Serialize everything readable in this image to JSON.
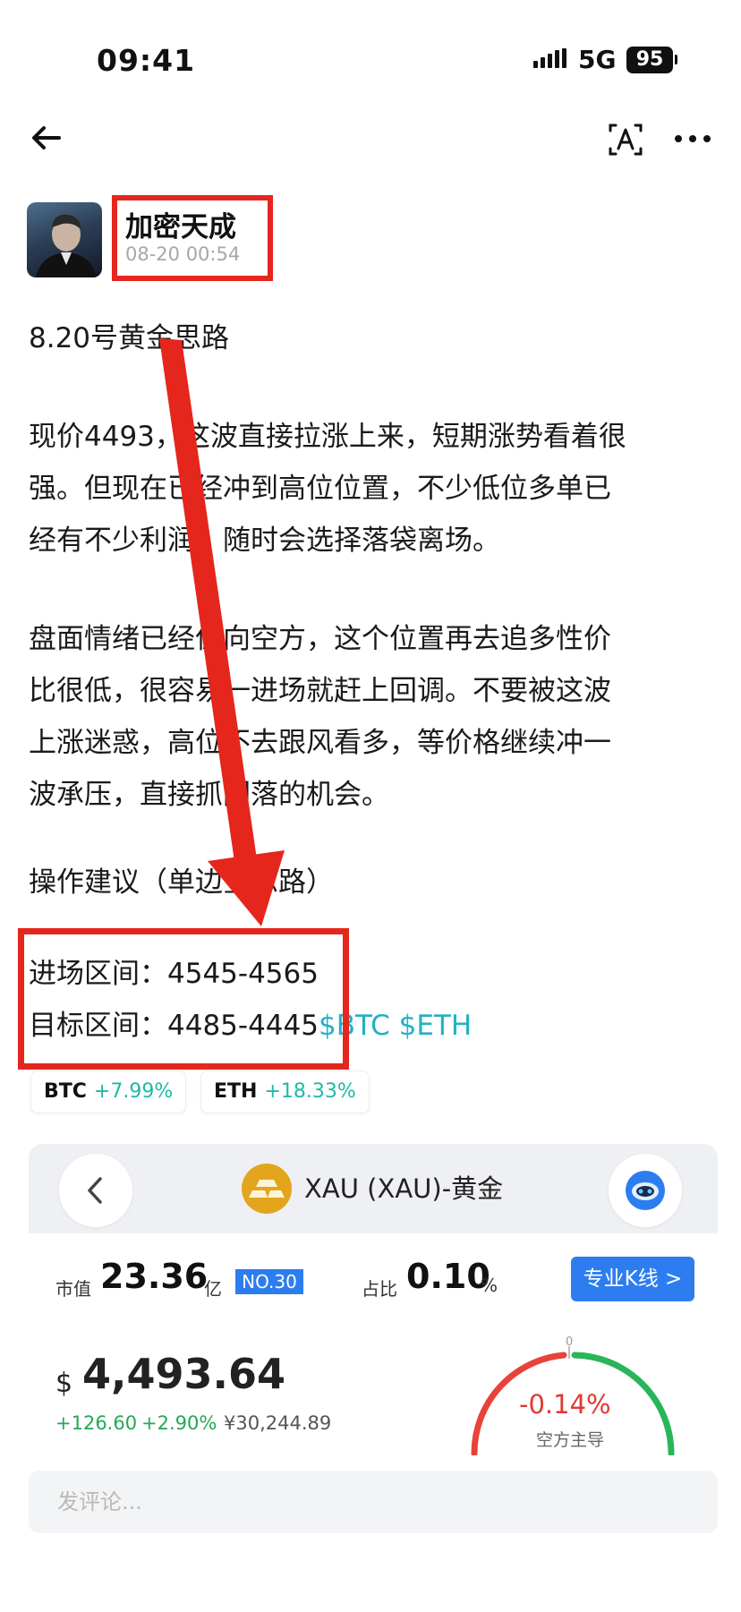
{
  "status_bar": {
    "time": "09:41",
    "network": "5G",
    "battery": "95"
  },
  "post": {
    "author": "加密天成",
    "timestamp": "08-20 00:54",
    "title_line": "8.20号黄金思路",
    "para1": [
      "现价4493，这波直接拉涨上来，短期涨势看着很",
      "强。但现在已经冲到高位位置，不少低位多单已",
      "经有不少利润，随时会选择落袋离场。"
    ],
    "para2": [
      "盘面情绪已经偏向空方，这个位置再去追多性价",
      "比很低，很容易一进场就赶上回调。不要被这波",
      "上涨迷惑，高位不去跟风看多，等价格继续冲一",
      "波承压，直接抓回落的机会。"
    ],
    "advice": "操作建议（单边空思路）",
    "entry": "进场区间：4545-4565",
    "target": "目标区间：4485-4445",
    "links": "$BTC $ETH"
  },
  "tags": [
    {
      "symbol": "BTC",
      "change": "+7.99%"
    },
    {
      "symbol": "ETH",
      "change": "+18.33%"
    }
  ],
  "asset_card": {
    "title": "XAU (XAU)-黄金",
    "market_cap_label": "市值",
    "market_cap_value": "23.36",
    "market_cap_unit": "亿",
    "rank": "NO.30",
    "share_label": "占比",
    "share_value": "0.10",
    "share_unit": "%",
    "kline_button": "专业K线 >",
    "price_symbol": "$",
    "price": "4,493.64",
    "change_abs": "+126.60",
    "change_pct": "+2.90%",
    "price_cny": "¥30,244.89",
    "gauge_value": "-0.14%",
    "gauge_label": "空方主导",
    "gauge_zero": "0"
  },
  "comment": {
    "placeholder": "发评论..."
  },
  "colors": {
    "annotation_red": "#e5261d",
    "link": "#22b0c6",
    "up_green": "#25a852",
    "brand_blue": "#2d7df0"
  }
}
